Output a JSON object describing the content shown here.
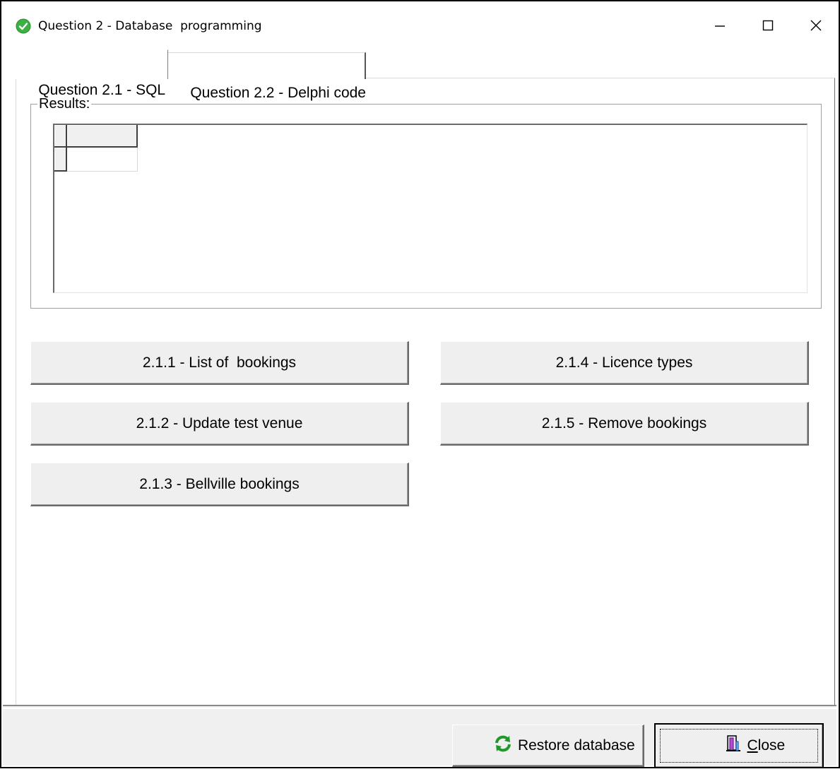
{
  "window": {
    "title": "Question 2 - Database  programming",
    "icon": "check-circle-icon",
    "controls": {
      "minimize": "minimize-icon",
      "maximize": "maximize-icon",
      "close": "close-icon"
    }
  },
  "tabs": [
    {
      "label": "Question 2.1 - SQL",
      "active": true
    },
    {
      "label": "Question 2.2 - Delphi code",
      "active": false
    }
  ],
  "results": {
    "label": "Results:"
  },
  "buttons": {
    "b211": "2.1.1 - List of  bookings",
    "b212": "2.1.2 - Update test venue",
    "b213": "2.1.3 - Bellville bookings",
    "b214": "2.1.4 - Licence types",
    "b215": "2.1.5 - Remove bookings"
  },
  "footer": {
    "restore_label": "Restore database",
    "restore_icon": "refresh-icon",
    "close_label": "Close",
    "close_icon": "door-exit-icon"
  },
  "colors": {
    "check_green": "#3cb043",
    "button_face": "#efefef",
    "panel_face": "#f0f0f0"
  }
}
